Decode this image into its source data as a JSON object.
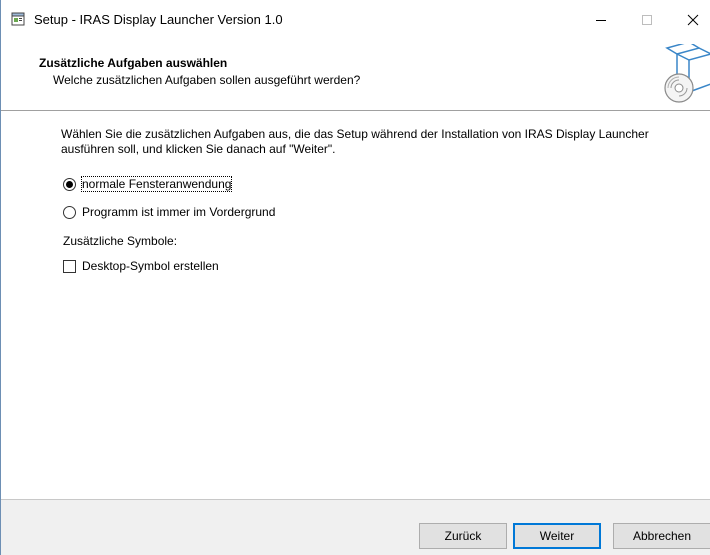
{
  "window": {
    "title": "Setup - IRAS Display Launcher Version 1.0",
    "minimize_glyph": "—",
    "maximize_glyph": "☐",
    "close_glyph": "✕"
  },
  "header": {
    "title": "Zusätzliche Aufgaben auswählen",
    "subtitle": "Welche zusätzlichen Aufgaben sollen ausgeführt werden?"
  },
  "content": {
    "instructions": "Wählen Sie die zusätzlichen Aufgaben aus, die das Setup während der Installation von IRAS Display Launcher ausführen soll, und klicken Sie danach auf \"Weiter\".",
    "radio_options": [
      {
        "label": "normale Fensteranwendung",
        "checked": true
      },
      {
        "label": "Programm ist immer im Vordergrund",
        "checked": false
      }
    ],
    "section_label": "Zusätzliche Symbole:",
    "checkbox_options": [
      {
        "label": "Desktop-Symbol erstellen",
        "checked": false
      }
    ]
  },
  "footer": {
    "back_label": "Zurück",
    "next_label": "Weiter",
    "cancel_label": "Abbrechen"
  },
  "colors": {
    "default_button_border": "#0078d7",
    "footer_background": "#f0f0f0"
  }
}
